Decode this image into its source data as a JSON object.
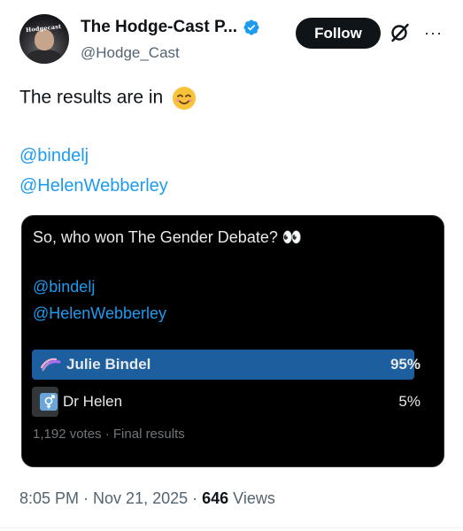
{
  "author": {
    "display_name": "The Hodge-Cast P...",
    "handle": "@Hodge_Cast",
    "avatar_text": "Hodgecast",
    "verified_color": "#1d9bf0"
  },
  "actions": {
    "follow_label": "Follow",
    "more_label": "···"
  },
  "tweet": {
    "text": "The results are in",
    "mentions": [
      "@bindelj",
      "@HelenWebberley"
    ]
  },
  "quoted_poll": {
    "question": "So, who won The Gender Debate? 👀",
    "mentions": [
      "@bindelj",
      "@HelenWebberley"
    ],
    "options": [
      {
        "label": "Julie Bindel",
        "percent_label": "95%",
        "fraction": 0.95,
        "icon": "intersex-flag-icon"
      },
      {
        "label": "Dr Helen",
        "percent_label": "5%",
        "fraction": 0.05,
        "icon": "transgender-symbol-icon"
      }
    ],
    "meta": "1,192 votes · Final results"
  },
  "footer": {
    "time": "8:05 PM",
    "sep1": " · ",
    "date": "Nov 21, 2025",
    "sep2": " · ",
    "views_count": "646",
    "views_label": " Views"
  },
  "colors": {
    "link": "#1d9bf0",
    "winner_bar": "#1d5f9e",
    "loser_bar": "#333639",
    "card_bg": "#000000"
  }
}
